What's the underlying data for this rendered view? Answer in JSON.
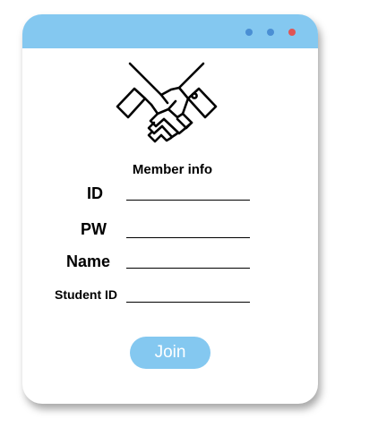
{
  "window": {
    "controls": [
      {
        "name": "minimize",
        "color": "#4a8fd4"
      },
      {
        "name": "maximize",
        "color": "#4a8fd4"
      },
      {
        "name": "close",
        "color": "#e05454"
      }
    ],
    "titlebar_color": "#84c8f0"
  },
  "logo": {
    "icon": "handshake-icon"
  },
  "form": {
    "heading": "Member info",
    "fields": [
      {
        "label": "ID",
        "value": "",
        "placeholder": ""
      },
      {
        "label": "PW",
        "value": "",
        "placeholder": ""
      },
      {
        "label": "Name",
        "value": "",
        "placeholder": ""
      },
      {
        "label": "Student ID",
        "value": "",
        "placeholder": ""
      }
    ],
    "submit_label": "Join",
    "accent_color": "#84c8f0"
  }
}
